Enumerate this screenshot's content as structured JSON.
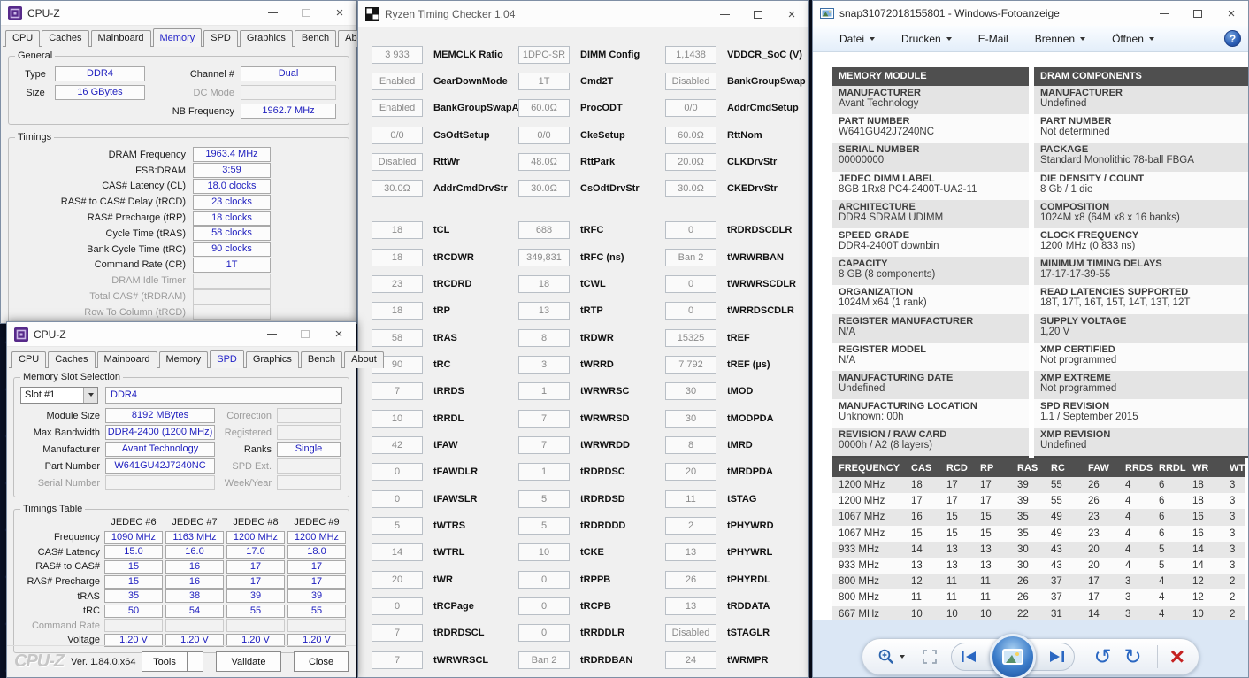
{
  "cpuz_memory": {
    "title": "CPU-Z",
    "tabs": [
      {
        "label": "CPU"
      },
      {
        "label": "Caches"
      },
      {
        "label": "Mainboard"
      },
      {
        "label": "Memory",
        "active": true
      },
      {
        "label": "SPD"
      },
      {
        "label": "Graphics"
      },
      {
        "label": "Bench"
      },
      {
        "label": "About"
      }
    ],
    "general": {
      "legend": "General",
      "type_label": "Type",
      "type_value": "DDR4",
      "size_label": "Size",
      "size_value": "16 GBytes",
      "channel_label": "Channel #",
      "channel_value": "Dual",
      "dc_mode_label": "DC Mode",
      "dc_mode_value": "",
      "nb_freq_label": "NB Frequency",
      "nb_freq_value": "1962.7 MHz"
    },
    "timings": {
      "legend": "Timings",
      "rows": [
        {
          "label": "DRAM Frequency",
          "value": "1963.4 MHz"
        },
        {
          "label": "FSB:DRAM",
          "value": "3:59"
        },
        {
          "label": "CAS# Latency (CL)",
          "value": "18.0 clocks"
        },
        {
          "label": "RAS# to CAS# Delay (tRCD)",
          "value": "23 clocks"
        },
        {
          "label": "RAS# Precharge (tRP)",
          "value": "18 clocks"
        },
        {
          "label": "Cycle Time (tRAS)",
          "value": "58 clocks"
        },
        {
          "label": "Bank Cycle Time (tRC)",
          "value": "90 clocks"
        },
        {
          "label": "Command Rate (CR)",
          "value": "1T"
        },
        {
          "label": "DRAM Idle Timer",
          "value": "",
          "muted": true
        },
        {
          "label": "Total CAS# (tRDRAM)",
          "value": "",
          "muted": true
        },
        {
          "label": "Row To Column (tRCD)",
          "value": "",
          "muted": true
        }
      ]
    }
  },
  "cpuz_spd": {
    "title": "CPU-Z",
    "tabs": [
      {
        "label": "CPU"
      },
      {
        "label": "Caches"
      },
      {
        "label": "Mainboard"
      },
      {
        "label": "Memory"
      },
      {
        "label": "SPD",
        "active": true
      },
      {
        "label": "Graphics"
      },
      {
        "label": "Bench"
      },
      {
        "label": "About"
      }
    ],
    "slot": {
      "legend": "Memory Slot Selection",
      "dropdown": "Slot #1",
      "type": "DDR4",
      "left": [
        {
          "label": "Module Size",
          "value": "8192 MBytes"
        },
        {
          "label": "Max Bandwidth",
          "value": "DDR4-2400 (1200 MHz)"
        },
        {
          "label": "Manufacturer",
          "value": "Avant Technology"
        },
        {
          "label": "Part Number",
          "value": "W641GU42J7240NC"
        },
        {
          "label": "Serial Number",
          "value": "",
          "muted": true
        }
      ],
      "right": [
        {
          "label": "Correction",
          "value": "",
          "muted": true
        },
        {
          "label": "Registered",
          "value": "",
          "muted": true
        },
        {
          "label": "Ranks",
          "value": "Single"
        },
        {
          "label": "SPD Ext.",
          "value": "",
          "muted": true
        },
        {
          "label": "Week/Year",
          "value": "",
          "muted": true
        }
      ]
    },
    "jedec": {
      "legend": "Timings Table",
      "columns": [
        "JEDEC #6",
        "JEDEC #7",
        "JEDEC #8",
        "JEDEC #9"
      ],
      "rows": [
        {
          "label": "Frequency",
          "v": [
            "1090 MHz",
            "1163 MHz",
            "1200 MHz",
            "1200 MHz"
          ]
        },
        {
          "label": "CAS# Latency",
          "v": [
            "15.0",
            "16.0",
            "17.0",
            "18.0"
          ]
        },
        {
          "label": "RAS# to CAS#",
          "v": [
            "15",
            "16",
            "17",
            "17"
          ]
        },
        {
          "label": "RAS# Precharge",
          "v": [
            "15",
            "16",
            "17",
            "17"
          ]
        },
        {
          "label": "tRAS",
          "v": [
            "35",
            "38",
            "39",
            "39"
          ]
        },
        {
          "label": "tRC",
          "v": [
            "50",
            "54",
            "55",
            "55"
          ]
        },
        {
          "label": "Command Rate",
          "v": [
            "",
            "",
            "",
            ""
          ],
          "muted": true
        },
        {
          "label": "Voltage",
          "v": [
            "1.20 V",
            "1.20 V",
            "1.20 V",
            "1.20 V"
          ]
        }
      ]
    },
    "footer": {
      "logo": "CPU-Z",
      "version": "Ver. 1.84.0.x64",
      "tools": "Tools",
      "validate": "Validate",
      "close": "Close"
    }
  },
  "rtc": {
    "title": "Ryzen Timing Checker 1.04",
    "config": [
      {
        "v": "3 933",
        "l": "MEMCLK Ratio"
      },
      {
        "v": "1DPC-SR",
        "l": "DIMM Config"
      },
      {
        "v": "1,1438",
        "l": "VDDCR_SoC (V)"
      },
      {
        "v": "Enabled",
        "l": "GearDownMode"
      },
      {
        "v": "1T",
        "l": "Cmd2T"
      },
      {
        "v": "Disabled",
        "l": "BankGroupSwap"
      },
      {
        "v": "Enabled",
        "l": "BankGroupSwapAlt"
      },
      {
        "v": "60.0Ω",
        "l": "ProcODT"
      },
      {
        "v": "0/0",
        "l": "AddrCmdSetup"
      },
      {
        "v": "0/0",
        "l": "CsOdtSetup"
      },
      {
        "v": "0/0",
        "l": "CkeSetup"
      },
      {
        "v": "60.0Ω",
        "l": "RttNom"
      },
      {
        "v": "Disabled",
        "l": "RttWr"
      },
      {
        "v": "48.0Ω",
        "l": "RttPark"
      },
      {
        "v": "20.0Ω",
        "l": "CLKDrvStr"
      },
      {
        "v": "30.0Ω",
        "l": "AddrCmdDrvStr"
      },
      {
        "v": "30.0Ω",
        "l": "CsOdtDrvStr"
      },
      {
        "v": "30.0Ω",
        "l": "CKEDrvStr"
      }
    ],
    "timings": [
      {
        "v": "18",
        "l": "tCL"
      },
      {
        "v": "688",
        "l": "tRFC"
      },
      {
        "v": "0",
        "l": "tRDRDSCDLR"
      },
      {
        "v": "18",
        "l": "tRCDWR"
      },
      {
        "v": "349,831",
        "l": "tRFC (ns)"
      },
      {
        "v": "Ban 2",
        "l": "tWRWRBAN"
      },
      {
        "v": "23",
        "l": "tRCDRD"
      },
      {
        "v": "18",
        "l": "tCWL"
      },
      {
        "v": "0",
        "l": "tWRWRSCDLR"
      },
      {
        "v": "18",
        "l": "tRP"
      },
      {
        "v": "13",
        "l": "tRTP"
      },
      {
        "v": "0",
        "l": "tWRRDSCDLR"
      },
      {
        "v": "58",
        "l": "tRAS"
      },
      {
        "v": "8",
        "l": "tRDWR"
      },
      {
        "v": "15325",
        "l": "tREF"
      },
      {
        "v": "90",
        "l": "tRC"
      },
      {
        "v": "3",
        "l": "tWRRD"
      },
      {
        "v": "7 792",
        "l": "tREF (µs)"
      },
      {
        "v": "7",
        "l": "tRRDS"
      },
      {
        "v": "1",
        "l": "tWRWRSC"
      },
      {
        "v": "30",
        "l": "tMOD"
      },
      {
        "v": "10",
        "l": "tRRDL"
      },
      {
        "v": "7",
        "l": "tWRWRSD"
      },
      {
        "v": "30",
        "l": "tMODPDA"
      },
      {
        "v": "42",
        "l": "tFAW"
      },
      {
        "v": "7",
        "l": "tWRWRDD"
      },
      {
        "v": "8",
        "l": "tMRD"
      },
      {
        "v": "0",
        "l": "tFAWDLR"
      },
      {
        "v": "1",
        "l": "tRDRDSC"
      },
      {
        "v": "20",
        "l": "tMRDPDA"
      },
      {
        "v": "0",
        "l": "tFAWSLR"
      },
      {
        "v": "5",
        "l": "tRDRDSD"
      },
      {
        "v": "11",
        "l": "tSTAG"
      },
      {
        "v": "5",
        "l": "tWTRS"
      },
      {
        "v": "5",
        "l": "tRDRDDD"
      },
      {
        "v": "2",
        "l": "tPHYWRD"
      },
      {
        "v": "14",
        "l": "tWTRL"
      },
      {
        "v": "10",
        "l": "tCKE"
      },
      {
        "v": "13",
        "l": "tPHYWRL"
      },
      {
        "v": "20",
        "l": "tWR"
      },
      {
        "v": "0",
        "l": "tRPPB"
      },
      {
        "v": "26",
        "l": "tPHYRDL"
      },
      {
        "v": "0",
        "l": "tRCPage"
      },
      {
        "v": "0",
        "l": "tRCPB"
      },
      {
        "v": "13",
        "l": "tRDDATA"
      },
      {
        "v": "7",
        "l": "tRDRDSCL"
      },
      {
        "v": "0",
        "l": "tRRDDLR"
      },
      {
        "v": "Disabled",
        "l": "tSTAGLR"
      },
      {
        "v": "7",
        "l": "tWRWRSCL"
      },
      {
        "v": "Ban 2",
        "l": "tRDRDBAN"
      },
      {
        "v": "24",
        "l": "tWRMPR"
      }
    ]
  },
  "photo": {
    "title": "snap31072018155801 - Windows-Fotoanzeige",
    "menu": [
      {
        "label": "Datei",
        "arrow": true
      },
      {
        "label": "Drucken",
        "arrow": true
      },
      {
        "label": "E-Mail"
      },
      {
        "label": "Brennen",
        "arrow": true
      },
      {
        "label": "Öffnen",
        "arrow": true
      }
    ],
    "help_label": "?",
    "module": {
      "header": "MEMORY MODULE",
      "rows": [
        {
          "label": "MANUFACTURER",
          "value": "Avant Technology"
        },
        {
          "label": "PART NUMBER",
          "value": "W641GU42J7240NC"
        },
        {
          "label": "SERIAL NUMBER",
          "value": "00000000"
        },
        {
          "label": "JEDEC DIMM LABEL",
          "value": "8GB 1Rx8 PC4-2400T-UA2-11"
        },
        {
          "label": "ARCHITECTURE",
          "value": "DDR4 SDRAM UDIMM"
        },
        {
          "label": "SPEED GRADE",
          "value": "DDR4-2400T downbin"
        },
        {
          "label": "CAPACITY",
          "value": "8 GB (8 components)"
        },
        {
          "label": "ORGANIZATION",
          "value": "1024M x64 (1 rank)"
        },
        {
          "label": "REGISTER MANUFACTURER",
          "value": "N/A"
        },
        {
          "label": "REGISTER MODEL",
          "value": "N/A"
        },
        {
          "label": "MANUFACTURING DATE",
          "value": "Undefined"
        },
        {
          "label": "MANUFACTURING LOCATION",
          "value": "Unknown: 00h"
        },
        {
          "label": "REVISION / RAW CARD",
          "value": "0000h / A2 (8 layers)"
        }
      ]
    },
    "dram": {
      "header": "DRAM COMPONENTS",
      "rows": [
        {
          "label": "MANUFACTURER",
          "value": "Undefined"
        },
        {
          "label": "PART NUMBER",
          "value": "Not determined"
        },
        {
          "label": "PACKAGE",
          "value": "Standard Monolithic 78-ball FBGA"
        },
        {
          "label": "DIE DENSITY / COUNT",
          "value": "8 Gb / 1 die"
        },
        {
          "label": "COMPOSITION",
          "value": "1024M x8 (64M x8 x 16 banks)"
        },
        {
          "label": "CLOCK FREQUENCY",
          "value": "1200 MHz (0,833 ns)"
        },
        {
          "label": "MINIMUM TIMING DELAYS",
          "value": "17-17-17-39-55"
        },
        {
          "label": "READ LATENCIES SUPPORTED",
          "value": "18T, 17T, 16T, 15T, 14T, 13T, 12T"
        },
        {
          "label": "SUPPLY VOLTAGE",
          "value": "1,20 V"
        },
        {
          "label": "XMP CERTIFIED",
          "value": "Not programmed"
        },
        {
          "label": "XMP EXTREME",
          "value": "Not programmed"
        },
        {
          "label": "SPD REVISION",
          "value": "1.1 / September 2015"
        },
        {
          "label": "XMP REVISION",
          "value": "Undefined"
        }
      ]
    },
    "freq": {
      "headers": [
        "FREQUENCY",
        "CAS",
        "RCD",
        "RP",
        "RAS",
        "RC",
        "FAW",
        "RRDS",
        "RRDL",
        "WR",
        "WTRS"
      ],
      "rows": [
        {
          "f": "1200 MHz",
          "c": [
            "18",
            "17",
            "17",
            "39",
            "55",
            "26",
            "4",
            "6",
            "18",
            "3"
          ]
        },
        {
          "f": "1200 MHz",
          "c": [
            "17",
            "17",
            "17",
            "39",
            "55",
            "26",
            "4",
            "6",
            "18",
            "3"
          ]
        },
        {
          "f": "1067 MHz",
          "c": [
            "16",
            "15",
            "15",
            "35",
            "49",
            "23",
            "4",
            "6",
            "16",
            "3"
          ]
        },
        {
          "f": "1067 MHz",
          "c": [
            "15",
            "15",
            "15",
            "35",
            "49",
            "23",
            "4",
            "6",
            "16",
            "3"
          ]
        },
        {
          "f": "933 MHz",
          "c": [
            "14",
            "13",
            "13",
            "30",
            "43",
            "20",
            "4",
            "5",
            "14",
            "3"
          ]
        },
        {
          "f": "933 MHz",
          "c": [
            "13",
            "13",
            "13",
            "30",
            "43",
            "20",
            "4",
            "5",
            "14",
            "3"
          ]
        },
        {
          "f": "800 MHz",
          "c": [
            "12",
            "11",
            "11",
            "26",
            "37",
            "17",
            "3",
            "4",
            "12",
            "2"
          ]
        },
        {
          "f": "800 MHz",
          "c": [
            "11",
            "11",
            "11",
            "26",
            "37",
            "17",
            "3",
            "4",
            "12",
            "2"
          ]
        },
        {
          "f": "667 MHz",
          "c": [
            "10",
            "10",
            "10",
            "22",
            "31",
            "14",
            "3",
            "4",
            "10",
            "2"
          ]
        }
      ]
    }
  }
}
